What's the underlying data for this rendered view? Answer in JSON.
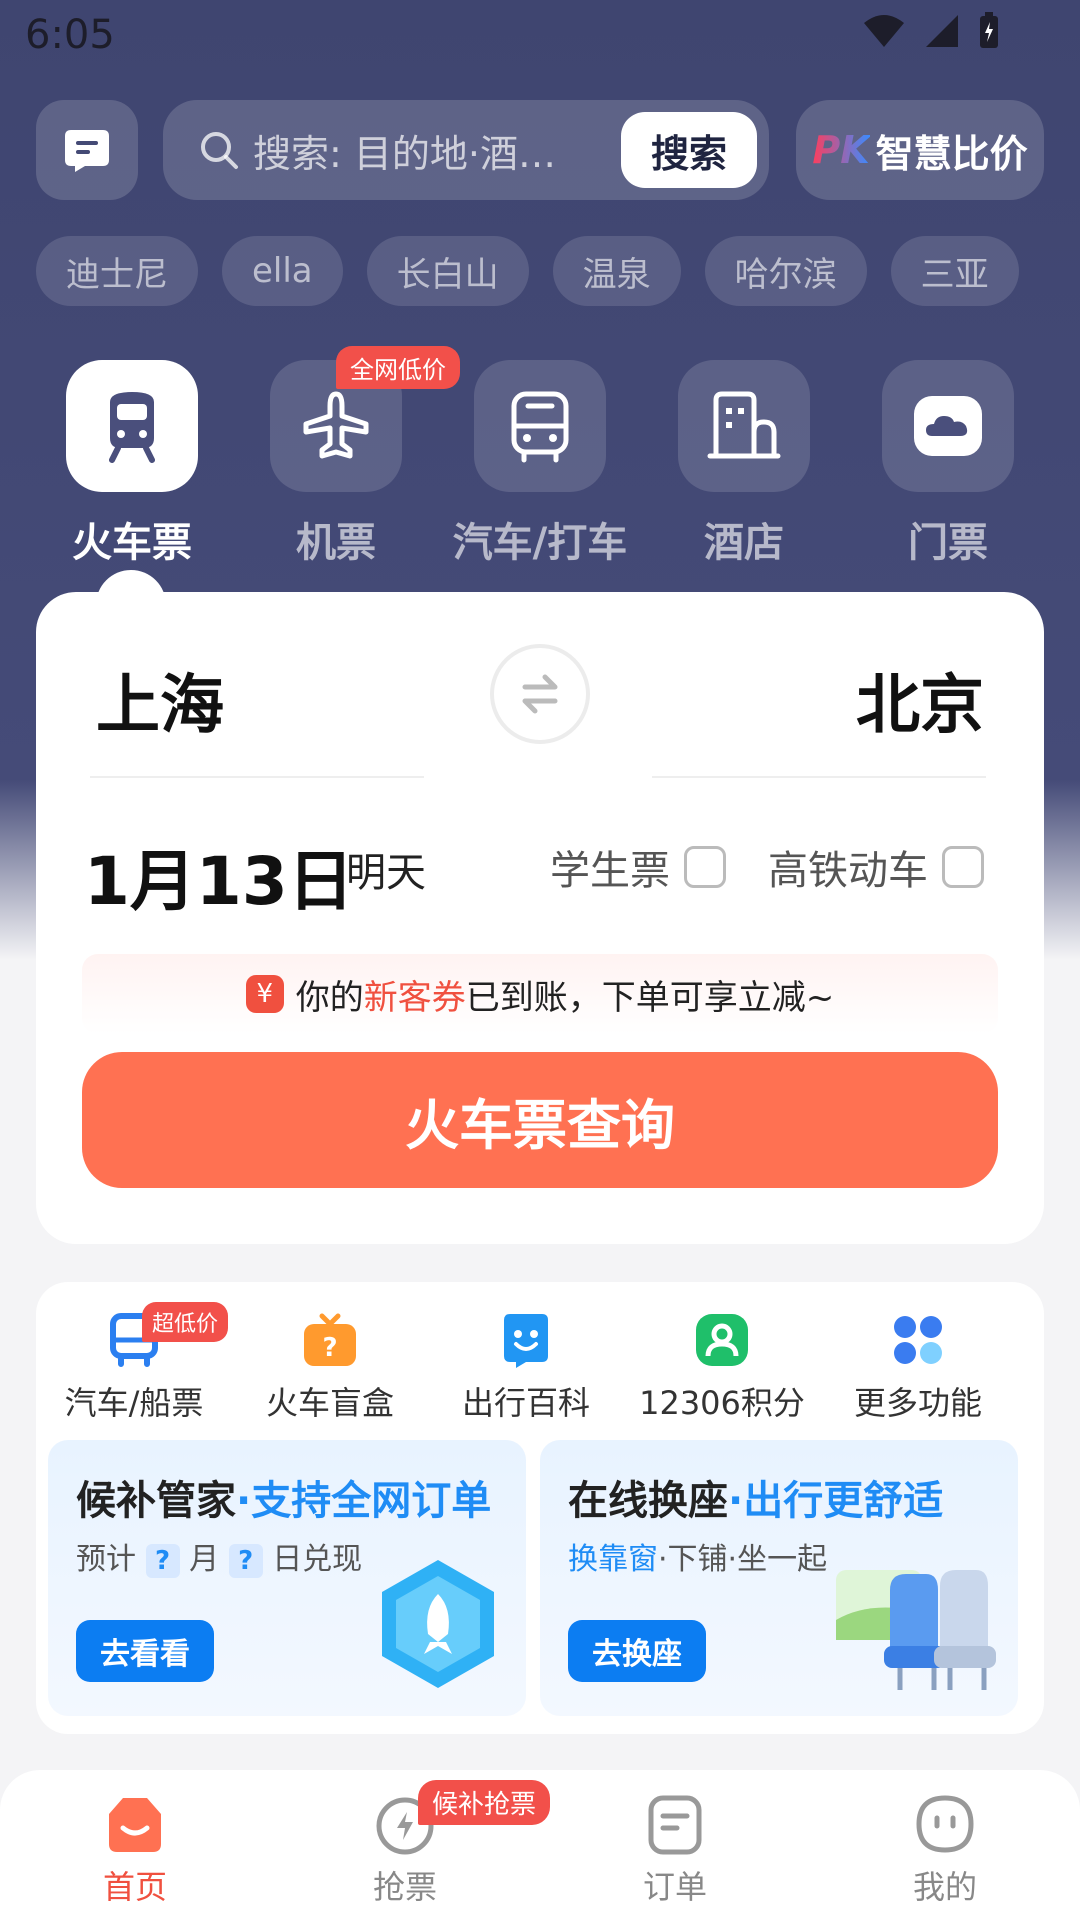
{
  "status_bar": {
    "time": "6:05"
  },
  "header": {
    "search_placeholder": "搜索: 目的地·酒店…",
    "search_button": "搜索",
    "compare_prefix": "PK",
    "compare_label": "智慧比价"
  },
  "hot_tags": [
    "迪士尼",
    "ella",
    "长白山",
    "温泉",
    "哈尔滨",
    "三亚"
  ],
  "categories": [
    {
      "label": "火车票",
      "icon": "train-icon",
      "active": true
    },
    {
      "label": "机票",
      "icon": "plane-icon",
      "badge": "全网低价"
    },
    {
      "label": "汽车/打车",
      "icon": "bus-icon"
    },
    {
      "label": "酒店",
      "icon": "hotel-icon"
    },
    {
      "label": "门票",
      "icon": "ticket-icon"
    }
  ],
  "booking": {
    "from": "上海",
    "to": "北京",
    "date": "1月13日",
    "weekday": "明天",
    "student_label": "学生票",
    "highspeed_label": "高铁动车",
    "promo_prefix": "你的",
    "promo_highlight": "新客券",
    "promo_suffix": "已到账，下单可享立减~",
    "query_button": "火车票查询"
  },
  "services": [
    {
      "label": "汽车/船票",
      "icon": "bus-ship-icon",
      "badge": "超低价"
    },
    {
      "label": "火车盲盒",
      "icon": "blind-box-icon"
    },
    {
      "label": "出行百科",
      "icon": "encyclopedia-icon"
    },
    {
      "label": "12306积分",
      "icon": "points-icon"
    },
    {
      "label": "更多功能",
      "icon": "more-icon"
    }
  ],
  "promo_cards": [
    {
      "title": "候补管家",
      "title_highlight": "·支持全网订单",
      "sub_1": "预计",
      "sub_q": "?",
      "sub_2": "月",
      "sub_3": "日兑现",
      "button": "去看看"
    },
    {
      "title": "在线换座",
      "title_highlight": "·出行更舒适",
      "sub_highlight": "换靠窗",
      "sub_rest": "·下铺·坐一起",
      "button": "去换座"
    }
  ],
  "bottom_nav": [
    {
      "label": "首页",
      "icon": "home-icon",
      "active": true
    },
    {
      "label": "抢票",
      "icon": "grab-ticket-icon",
      "badge": "候补抢票"
    },
    {
      "label": "订单",
      "icon": "order-icon"
    },
    {
      "label": "我的",
      "icon": "profile-icon"
    }
  ],
  "colors": {
    "accent": "#ff7152",
    "brand_blue": "#0c7df2",
    "header_bg": "#3f4570"
  }
}
